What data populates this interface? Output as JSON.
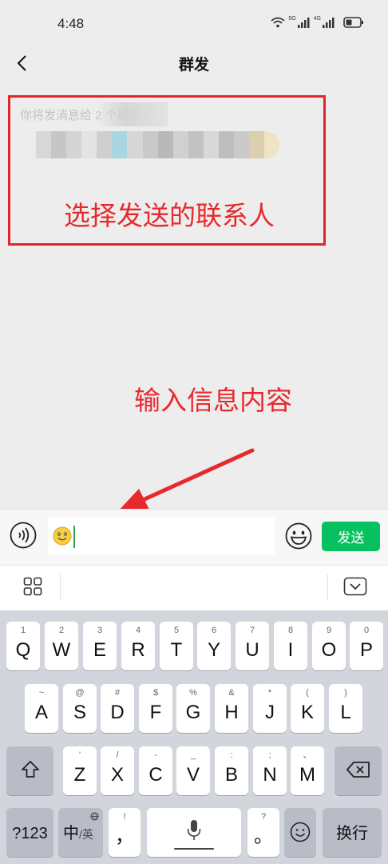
{
  "status_bar": {
    "time": "4:48",
    "signal_1_tag": "5G",
    "signal_2_tag": "4G"
  },
  "header": {
    "title": "群发",
    "back_icon": "chevron-left-icon"
  },
  "recipients": {
    "hint": "你将发消息给 2 个朋友"
  },
  "annotations": {
    "contacts": "选择发送的联系人",
    "message": "输入信息内容",
    "color": "#e8292c"
  },
  "input_bar": {
    "voice_icon": "voice-icon",
    "emoji_content": "smiley-emoji",
    "emoji_icon": "emoji-icon",
    "send_label": "发送",
    "accent_color": "#07c160"
  },
  "ime_toolbar": {
    "menu_icon": "grid-menu-icon",
    "collapse_icon": "keyboard-collapse-icon"
  },
  "keyboard": {
    "row1": [
      {
        "hint": "1",
        "key": "Q"
      },
      {
        "hint": "2",
        "key": "W"
      },
      {
        "hint": "3",
        "key": "E"
      },
      {
        "hint": "4",
        "key": "R"
      },
      {
        "hint": "5",
        "key": "T"
      },
      {
        "hint": "6",
        "key": "Y"
      },
      {
        "hint": "7",
        "key": "U"
      },
      {
        "hint": "8",
        "key": "I"
      },
      {
        "hint": "9",
        "key": "O"
      },
      {
        "hint": "0",
        "key": "P"
      }
    ],
    "row2": [
      {
        "hint": "~",
        "key": "A"
      },
      {
        "hint": "@",
        "key": "S"
      },
      {
        "hint": "#",
        "key": "D"
      },
      {
        "hint": "$",
        "key": "F"
      },
      {
        "hint": "%",
        "key": "G"
      },
      {
        "hint": "&",
        "key": "H"
      },
      {
        "hint": "*",
        "key": "J"
      },
      {
        "hint": "(",
        "key": "K"
      },
      {
        "hint": ")",
        "key": "L"
      }
    ],
    "row3": [
      {
        "hint": "'",
        "key": "Z"
      },
      {
        "hint": "/",
        "key": "X"
      },
      {
        "hint": "-",
        "key": "C"
      },
      {
        "hint": "_",
        "key": "V"
      },
      {
        "hint": ":",
        "key": "B"
      },
      {
        "hint": ";",
        "key": "N"
      },
      {
        "hint": "、",
        "key": "M"
      }
    ],
    "num_label": "?123",
    "lang_label": "中",
    "lang_sub": "/英",
    "comma_hint": "!",
    "comma_key": "，",
    "period_hint": "?",
    "period_key": "。",
    "enter_label": "换行"
  }
}
